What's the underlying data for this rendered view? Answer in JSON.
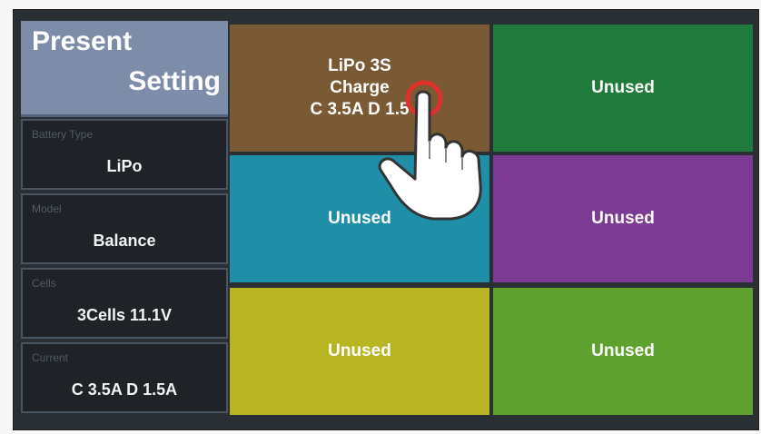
{
  "left_panel": {
    "title_line1": "Present",
    "title_line2": "Setting",
    "fields": [
      {
        "label": "Battery Type",
        "value": "LiPo"
      },
      {
        "label": "Model",
        "value": "Balance"
      },
      {
        "label": "Cells",
        "value": "3Cells  11.1V"
      },
      {
        "label": "Current",
        "value": "C 3.5A  D 1.5A"
      }
    ]
  },
  "slots": [
    {
      "line1": "LiPo 3S",
      "line2": "Charge",
      "line3": "C 3.5A  D 1.5",
      "color": "#7a5a34"
    },
    {
      "line1": "Unused",
      "color": "#1f7a3c"
    },
    {
      "line1": "Unused",
      "color": "#1f8fa8"
    },
    {
      "line1": "Unused",
      "color": "#7b3b93"
    },
    {
      "line1": "Unused",
      "color": "#b7b522"
    },
    {
      "line1": "Unused",
      "color": "#5ea12e"
    }
  ],
  "icons": {
    "pointer": "hand-pointer-icon"
  },
  "colors": {
    "background": "#2a2f33",
    "title_bg": "#7d8ca8",
    "tap_ring": "#e0302a"
  }
}
